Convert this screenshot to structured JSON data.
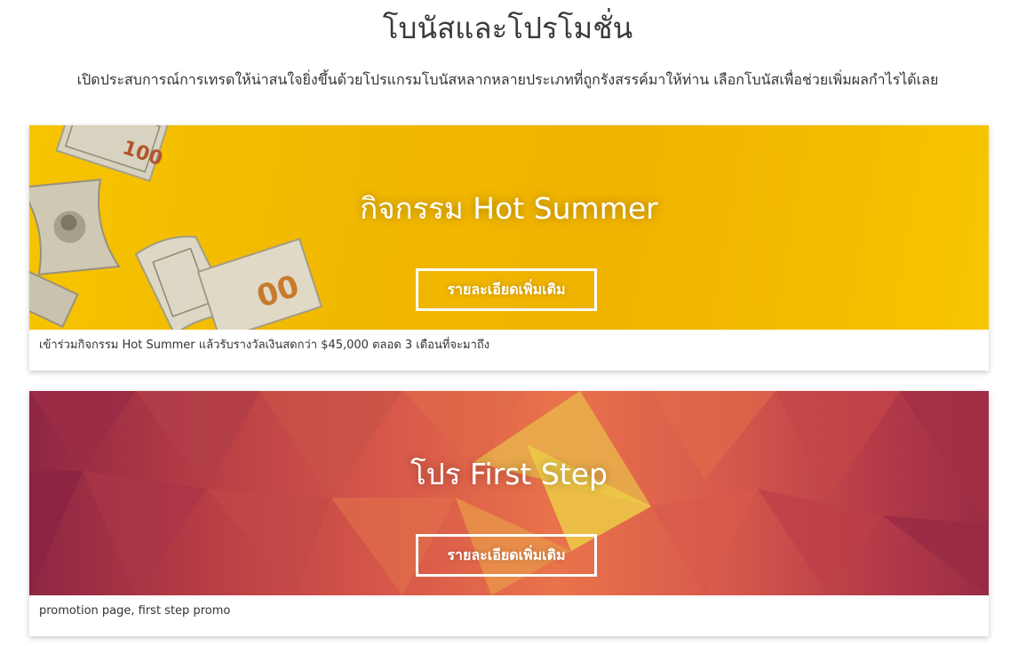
{
  "page": {
    "title": "โบนัสและโปรโมชั่น",
    "subtitle": "เปิดประสบการณ์การเทรดให้น่าสนใจยิ่งขึ้นด้วยโปรแกรมโบนัสหลากหลายประเภทที่ถูกรังสรรค์มาให้ท่าน เลือกโบนัสเพื่อช่วยเพิ่มผลกำไรได้เลย"
  },
  "promotions": [
    {
      "title": "กิจกรรม Hot Summer",
      "button_label": "รายละเอียดเพิ่มเติม",
      "caption": "เข้าร่วมกิจกรรม Hot Summer แล้วรับรางวัลเงินสดกว่า $45,000 ตลอด 3 เดือนที่จะมาถึง",
      "banner_color": "#f2b800"
    },
    {
      "title": "โปร First Step",
      "button_label": "รายละเอียดเพิ่มเติม",
      "caption": "promotion page, first step promo",
      "banner_color": "#d8584a"
    }
  ],
  "icons": {
    "summer_banner_art": "flying-banknotes-illustration",
    "firststep_banner_art": "low-poly-pattern"
  }
}
